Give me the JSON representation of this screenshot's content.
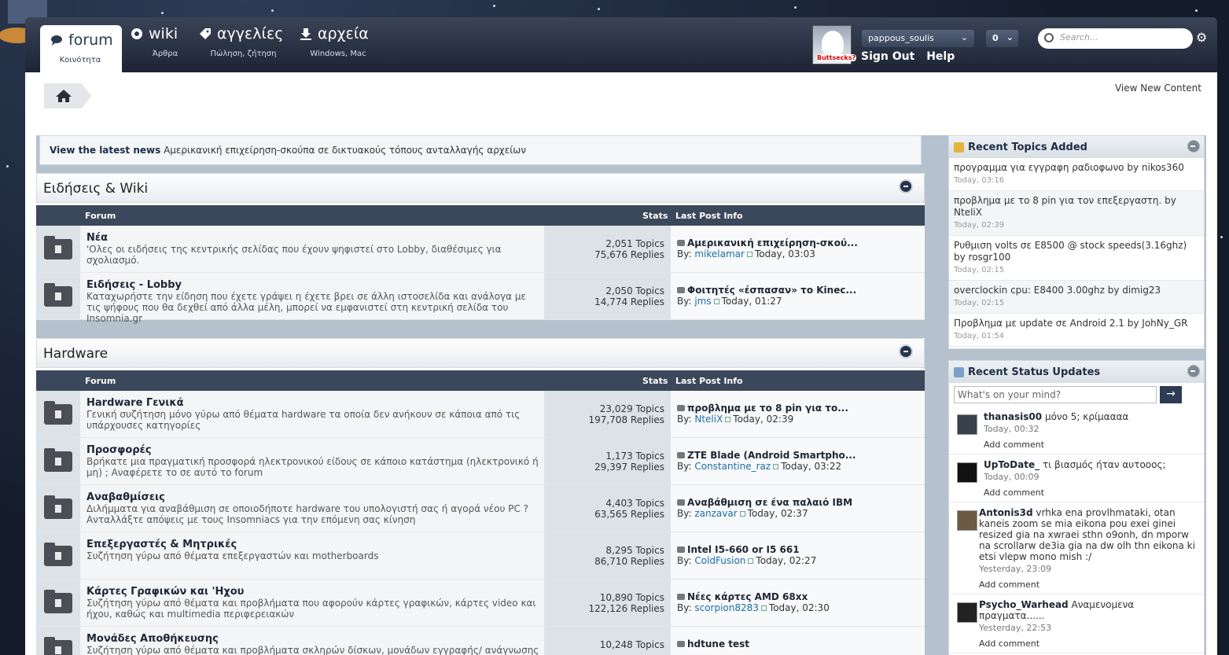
{
  "nav": {
    "tabs": [
      {
        "label": "forum",
        "sub": "Κοινότητα"
      },
      {
        "label": "wiki",
        "sub": "Άρθρα"
      },
      {
        "label": "αγγελίες",
        "sub": "Πώληση, ζήτηση"
      },
      {
        "label": "αρχεία",
        "sub": "Windows, Mac"
      }
    ],
    "avatar_badge": "Buttsecks?",
    "username": "pappous_soulis",
    "notifications": "0",
    "sign_out": "Sign Out",
    "help": "Help",
    "search_placeholder": "Search..."
  },
  "view_new_content": "View New Content",
  "news": {
    "label": "View the latest news",
    "text": "Αμερικανική επιχείρηση-σκούπα σε δικτυακούς τόπους ανταλλαγής αρχείων"
  },
  "columns": {
    "forum": "Forum",
    "stats": "Stats",
    "last": "Last Post Info"
  },
  "categories": [
    {
      "title": "Ειδήσεις & Wiki",
      "forums": [
        {
          "title": "Νέα",
          "desc": "'Ολες οι ειδήσεις της κεντρικής σελίδας που έχουν ψηφιστεί στο Lobby, διαθέσιμες για σχολιασμό.",
          "topics": "2,051 Topics",
          "replies": "75,676 Replies",
          "last_title": "Αμερικανική επιχείρηση-σκού...",
          "by": "By:",
          "last_user": "mikelamar",
          "last_time": "Today, 03:03"
        },
        {
          "title": "Ειδήσεις - Lobby",
          "desc": "Καταχωρήστε την είδηση που έχετε γράψει η έχετε βρει σε άλλη ιστοσελίδα και ανάλογα με τις ψήφους που θα δεχθεί από άλλα μέλη, μπορεί να εμφανιστεί στη κεντρική σελίδα του Insomnia.gr",
          "topics": "2,050 Topics",
          "replies": "14,774 Replies",
          "last_title": "Φοιτητές «έσπασαν» το Kinec...",
          "by": "By:",
          "last_user": "jms",
          "last_time": "Today, 01:27"
        }
      ]
    },
    {
      "title": "Hardware",
      "forums": [
        {
          "title": "Hardware Γενικά",
          "desc": "Γενική συζήτηση μόνο γύρω από θέματα hardware τα οποία δεν ανήκουν σε κάποια από τις υπάρχουσες κατηγορίες",
          "topics": "23,029 Topics",
          "replies": "197,708 Replies",
          "last_title": "προβλημα με το 8 pin για το...",
          "by": "By:",
          "last_user": "NteliX",
          "last_time": "Today, 02:39"
        },
        {
          "title": "Προσφορές",
          "desc": "Βρήκατε μια πραγματική προσφορά ηλεκτρονικού είδους σε κάποιο κατάστημα (ηλεκτρονικό ή μη) ; Αναφέρετε το σε αυτό το forum",
          "topics": "1,173 Topics",
          "replies": "29,397 Replies",
          "last_title": "ZTE Blade (Android Smartpho...",
          "by": "By:",
          "last_user": "Constantine_raz",
          "last_time": "Today, 03:22"
        },
        {
          "title": "Αναβαθμίσεις",
          "desc": "Διλήμματα για αναβάθμιση σε οποιοδήποτε hardware του υπολογιστή σας ή αγορά νέου PC ? Ανταλλάξτε απόψεις με τους Insomniacs για την επόμενη σας κίνηση",
          "topics": "4,403 Topics",
          "replies": "63,565 Replies",
          "last_title": "Αναβάθμιση σε ένα παλαιό IBM",
          "by": "By:",
          "last_user": "zanzavar",
          "last_time": "Today, 02:37"
        },
        {
          "title": "Επεξεργαστές & Μητρικές",
          "desc": "Συζήτηση γύρω από θέματα επεξεργαστών και motherboards",
          "topics": "8,295 Topics",
          "replies": "86,710 Replies",
          "last_title": "Intel I5-660 or I5 661",
          "by": "By:",
          "last_user": "ColdFusion",
          "last_time": "Today, 02:27"
        },
        {
          "title": "Κάρτες Γραφικών και 'Ηχου",
          "desc": "Συζήτηση γύρω από θέματα και προβλήματα που αφορούν κάρτες γραφικών, κάρτες video και ήχου, καθώς και multimedia περιφερειακών",
          "topics": "10,890 Topics",
          "replies": "122,126 Replies",
          "last_title": "Νέες κάρτες AMD 68xx",
          "by": "By:",
          "last_user": "scorpion8283",
          "last_time": "Today, 02:30"
        },
        {
          "title": "Μονάδες Αποθήκευσης",
          "desc": "Συζήτηση γύρω από θέματα και προβλήματα σκληρών δίσκων, μονάδων εγγραφής/ ανάγνωσης DVD/",
          "topics": "10,248 Topics",
          "replies": "",
          "last_title": "hdtune test",
          "by": "",
          "last_user": "",
          "last_time": ""
        }
      ]
    }
  ],
  "recent_topics": {
    "title": "Recent Topics Added",
    "items": [
      {
        "text": "προγραμμα για εγγραφη ραδιοφωνο by nikos360",
        "when": "Today, 03:16"
      },
      {
        "text": "προβλημα με το 8 pin για τον επεξεργαστη. by NteliX",
        "when": "Today, 02:39"
      },
      {
        "text": "Ρυθμιση volts σε E8500 @ stock speeds(3.16ghz) by rosgr100",
        "when": "Today, 02:15"
      },
      {
        "text": "overclockin cpu: E8400 3.00ghz by dimig23",
        "when": "Today, 02:15"
      },
      {
        "text": "Προβλημα με update σε Android 2.1 by JohNy_GR",
        "when": "Today, 01:54"
      }
    ]
  },
  "status_updates": {
    "title": "Recent Status Updates",
    "placeholder": "What's on your mind?",
    "go": "→",
    "add_comment": "Add comment",
    "items": [
      {
        "user": "thanasis00",
        "text": "μόνο 5; κρίμαααα",
        "when": "Today, 00:32"
      },
      {
        "user": "UpToDate_",
        "text": "τι βιασμός ήταν αυτοοος;",
        "when": "Today, 00:09"
      },
      {
        "user": "Antonis3d",
        "text": "vrhka ena provlhmataki, otan kaneis zoom se mia eikona pou exei ginei resized gia na xwraei sthn o9onh, dn mporw na scrollarw de3ia gia na dw olh thn eikona ki etsi vlepw mono mish :/",
        "when": "Yesterday, 23:09"
      },
      {
        "user": "Psycho_Warhead",
        "text": "Αναμενομενα πραγματα......",
        "when": "Yesterday, 22:53"
      }
    ]
  },
  "colors": {
    "nav_dark": "#1c2434",
    "column_head": "#3b475a",
    "link": "#1b6fa8"
  }
}
